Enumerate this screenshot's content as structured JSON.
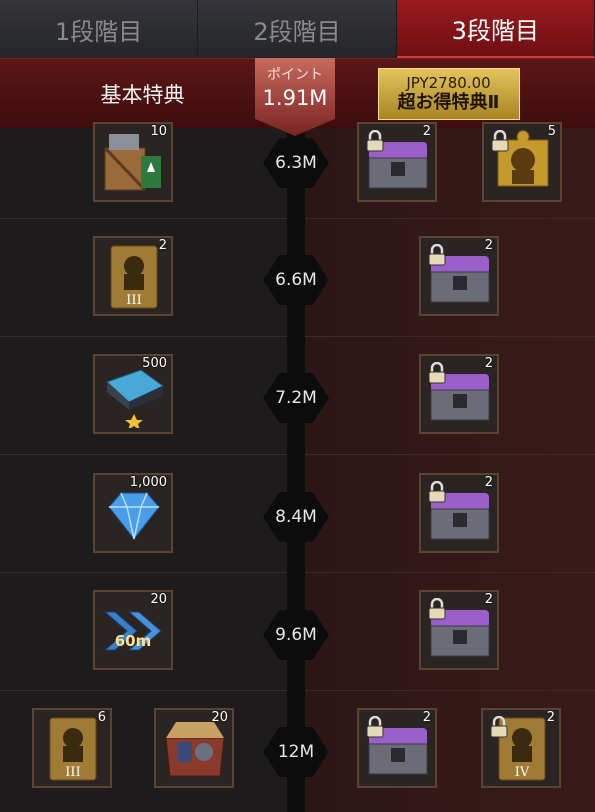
{
  "tabs": [
    {
      "label": "1段階目"
    },
    {
      "label": "2段階目"
    },
    {
      "label": "3段階目"
    }
  ],
  "header": {
    "basic_label": "基本特典",
    "points_label": "ポイント",
    "points_value": "1.91M",
    "premium_price": "JPY2780.00",
    "premium_title": "超お得特典Ⅱ"
  },
  "rows": [
    {
      "threshold": "6.3M",
      "basic": [
        {
          "icon": "supply-crate-icon",
          "qty": "10"
        }
      ],
      "premium": [
        {
          "icon": "purple-chest-icon",
          "qty": "2"
        },
        {
          "icon": "gold-puzzle-portrait-icon",
          "qty": "5"
        }
      ]
    },
    {
      "threshold": "6.6M",
      "basic": [
        {
          "icon": "officer-card-rank-3-icon",
          "qty": "2"
        }
      ],
      "premium": [
        {
          "icon": "purple-chest-icon",
          "qty": "2"
        }
      ]
    },
    {
      "threshold": "7.2M",
      "basic": [
        {
          "icon": "blue-crystal-chip-icon",
          "qty": "500"
        }
      ],
      "premium": [
        {
          "icon": "purple-chest-icon",
          "qty": "2"
        }
      ]
    },
    {
      "threshold": "8.4M",
      "basic": [
        {
          "icon": "diamond-icon",
          "qty": "1,000"
        }
      ],
      "premium": [
        {
          "icon": "purple-chest-icon",
          "qty": "2"
        }
      ]
    },
    {
      "threshold": "9.6M",
      "basic": [
        {
          "icon": "speedup-icon",
          "qty": "20",
          "label": "60m"
        }
      ],
      "premium": [
        {
          "icon": "purple-chest-icon",
          "qty": "2"
        }
      ]
    },
    {
      "threshold": "12M",
      "basic": [
        {
          "icon": "officer-card-rank-3-icon",
          "qty": "6"
        },
        {
          "icon": "resource-box-icon",
          "qty": "20"
        }
      ],
      "premium": [
        {
          "icon": "purple-chest-icon",
          "qty": "2"
        },
        {
          "icon": "officer-card-rank-4-icon",
          "qty": "2"
        }
      ]
    }
  ]
}
